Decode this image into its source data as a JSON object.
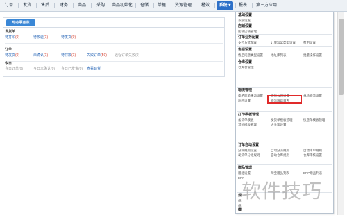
{
  "nav": {
    "items": [
      {
        "label": "订单"
      },
      {
        "label": "发货"
      },
      {
        "label": "售后"
      },
      {
        "label": "财务"
      },
      {
        "label": "商品"
      },
      {
        "label": "采购"
      },
      {
        "label": "商品初始化"
      },
      {
        "label": "仓储"
      },
      {
        "label": "单据"
      },
      {
        "label": "资源管理"
      },
      {
        "label": "稽效"
      },
      {
        "label": "系统"
      },
      {
        "label": "报表"
      },
      {
        "label": "第三方应用"
      }
    ],
    "active_index": 11,
    "active_caret": "▾"
  },
  "panel": {
    "tab_label": "动态事务表",
    "sections": [
      {
        "title": "发货单",
        "items": [
          {
            "label": "待打印",
            "count": "(0)"
          },
          {
            "label": "待校验",
            "count": "(1)"
          },
          {
            "label": "待发货",
            "count": "(0)"
          }
        ]
      },
      {
        "title": "订单",
        "items": [
          {
            "label": "待发货",
            "count": "(0)"
          },
          {
            "label": "未确认",
            "count": "(1)"
          },
          {
            "label": "待付款",
            "count": "(1)"
          },
          {
            "label": "失败订单",
            "count": "(59)"
          },
          {
            "label": "远程订单失败",
            "count": "(0)"
          }
        ]
      },
      {
        "title": "今日",
        "items": [
          {
            "label": "今日订单",
            "count": "(0)"
          },
          {
            "label": "今日未确认",
            "count": "(0)"
          },
          {
            "label": "今日已发货",
            "count": "(0)"
          },
          {
            "label": "查看缺货",
            "count": ""
          }
        ]
      }
    ]
  },
  "dropdown": {
    "groups": [
      {
        "title": "基础设置",
        "rows": [
          [
            "系统设置"
          ]
        ]
      },
      {
        "title": "店铺设置",
        "rows": [
          [
            "店铺店铺管理"
          ]
        ]
      },
      {
        "title": "订单业务配置",
        "rows": [
          [
            "支付方式配置",
            "订单异常类型设置",
            "费用设置"
          ]
        ]
      },
      {
        "title": "售后设置",
        "rows": [
          [
            "售后问题类型设置",
            "地址库列表",
            "批量操作设置"
          ]
        ]
      },
      {
        "title": "仓库设置",
        "rows": [
          [
            "仓库仓管理"
          ]
        ]
      },
      {
        "title": "物流管理",
        "rows": [
          [
            "电子面单来源设置",
            "物流公司设置",
            "林场物流设置"
          ],
          [
            "地区设置",
            "物流跟踪日志"
          ]
        ]
      },
      {
        "title": "打印模板管理",
        "rows": [
          [
            "备货单模板",
            "发货单模板管理",
            "快递单模板管理"
          ],
          [
            "其他模板管理",
            "大头笔设置"
          ]
        ]
      },
      {
        "title": "订单自动设置",
        "rows": [
          [
            "分派规则设置",
            "自动分派规则",
            "自动审单规则"
          ],
          [
            "发货单分组规则",
            "自动仓库规则",
            "仓库审核设置"
          ]
        ]
      },
      {
        "title": "赠品管理",
        "rows": [
          [
            "赠品设置",
            "淘宝赠品列表",
            "ERP赠品列表"
          ],
          [
            "ERP"
          ]
        ]
      },
      {
        "title": "规",
        "rows": [
          [
            "规"
          ],
          [
            "规"
          ]
        ]
      },
      {
        "title": "模",
        "rows": [
          [
            "模"
          ]
        ]
      }
    ]
  },
  "watermark": "软件技巧"
}
